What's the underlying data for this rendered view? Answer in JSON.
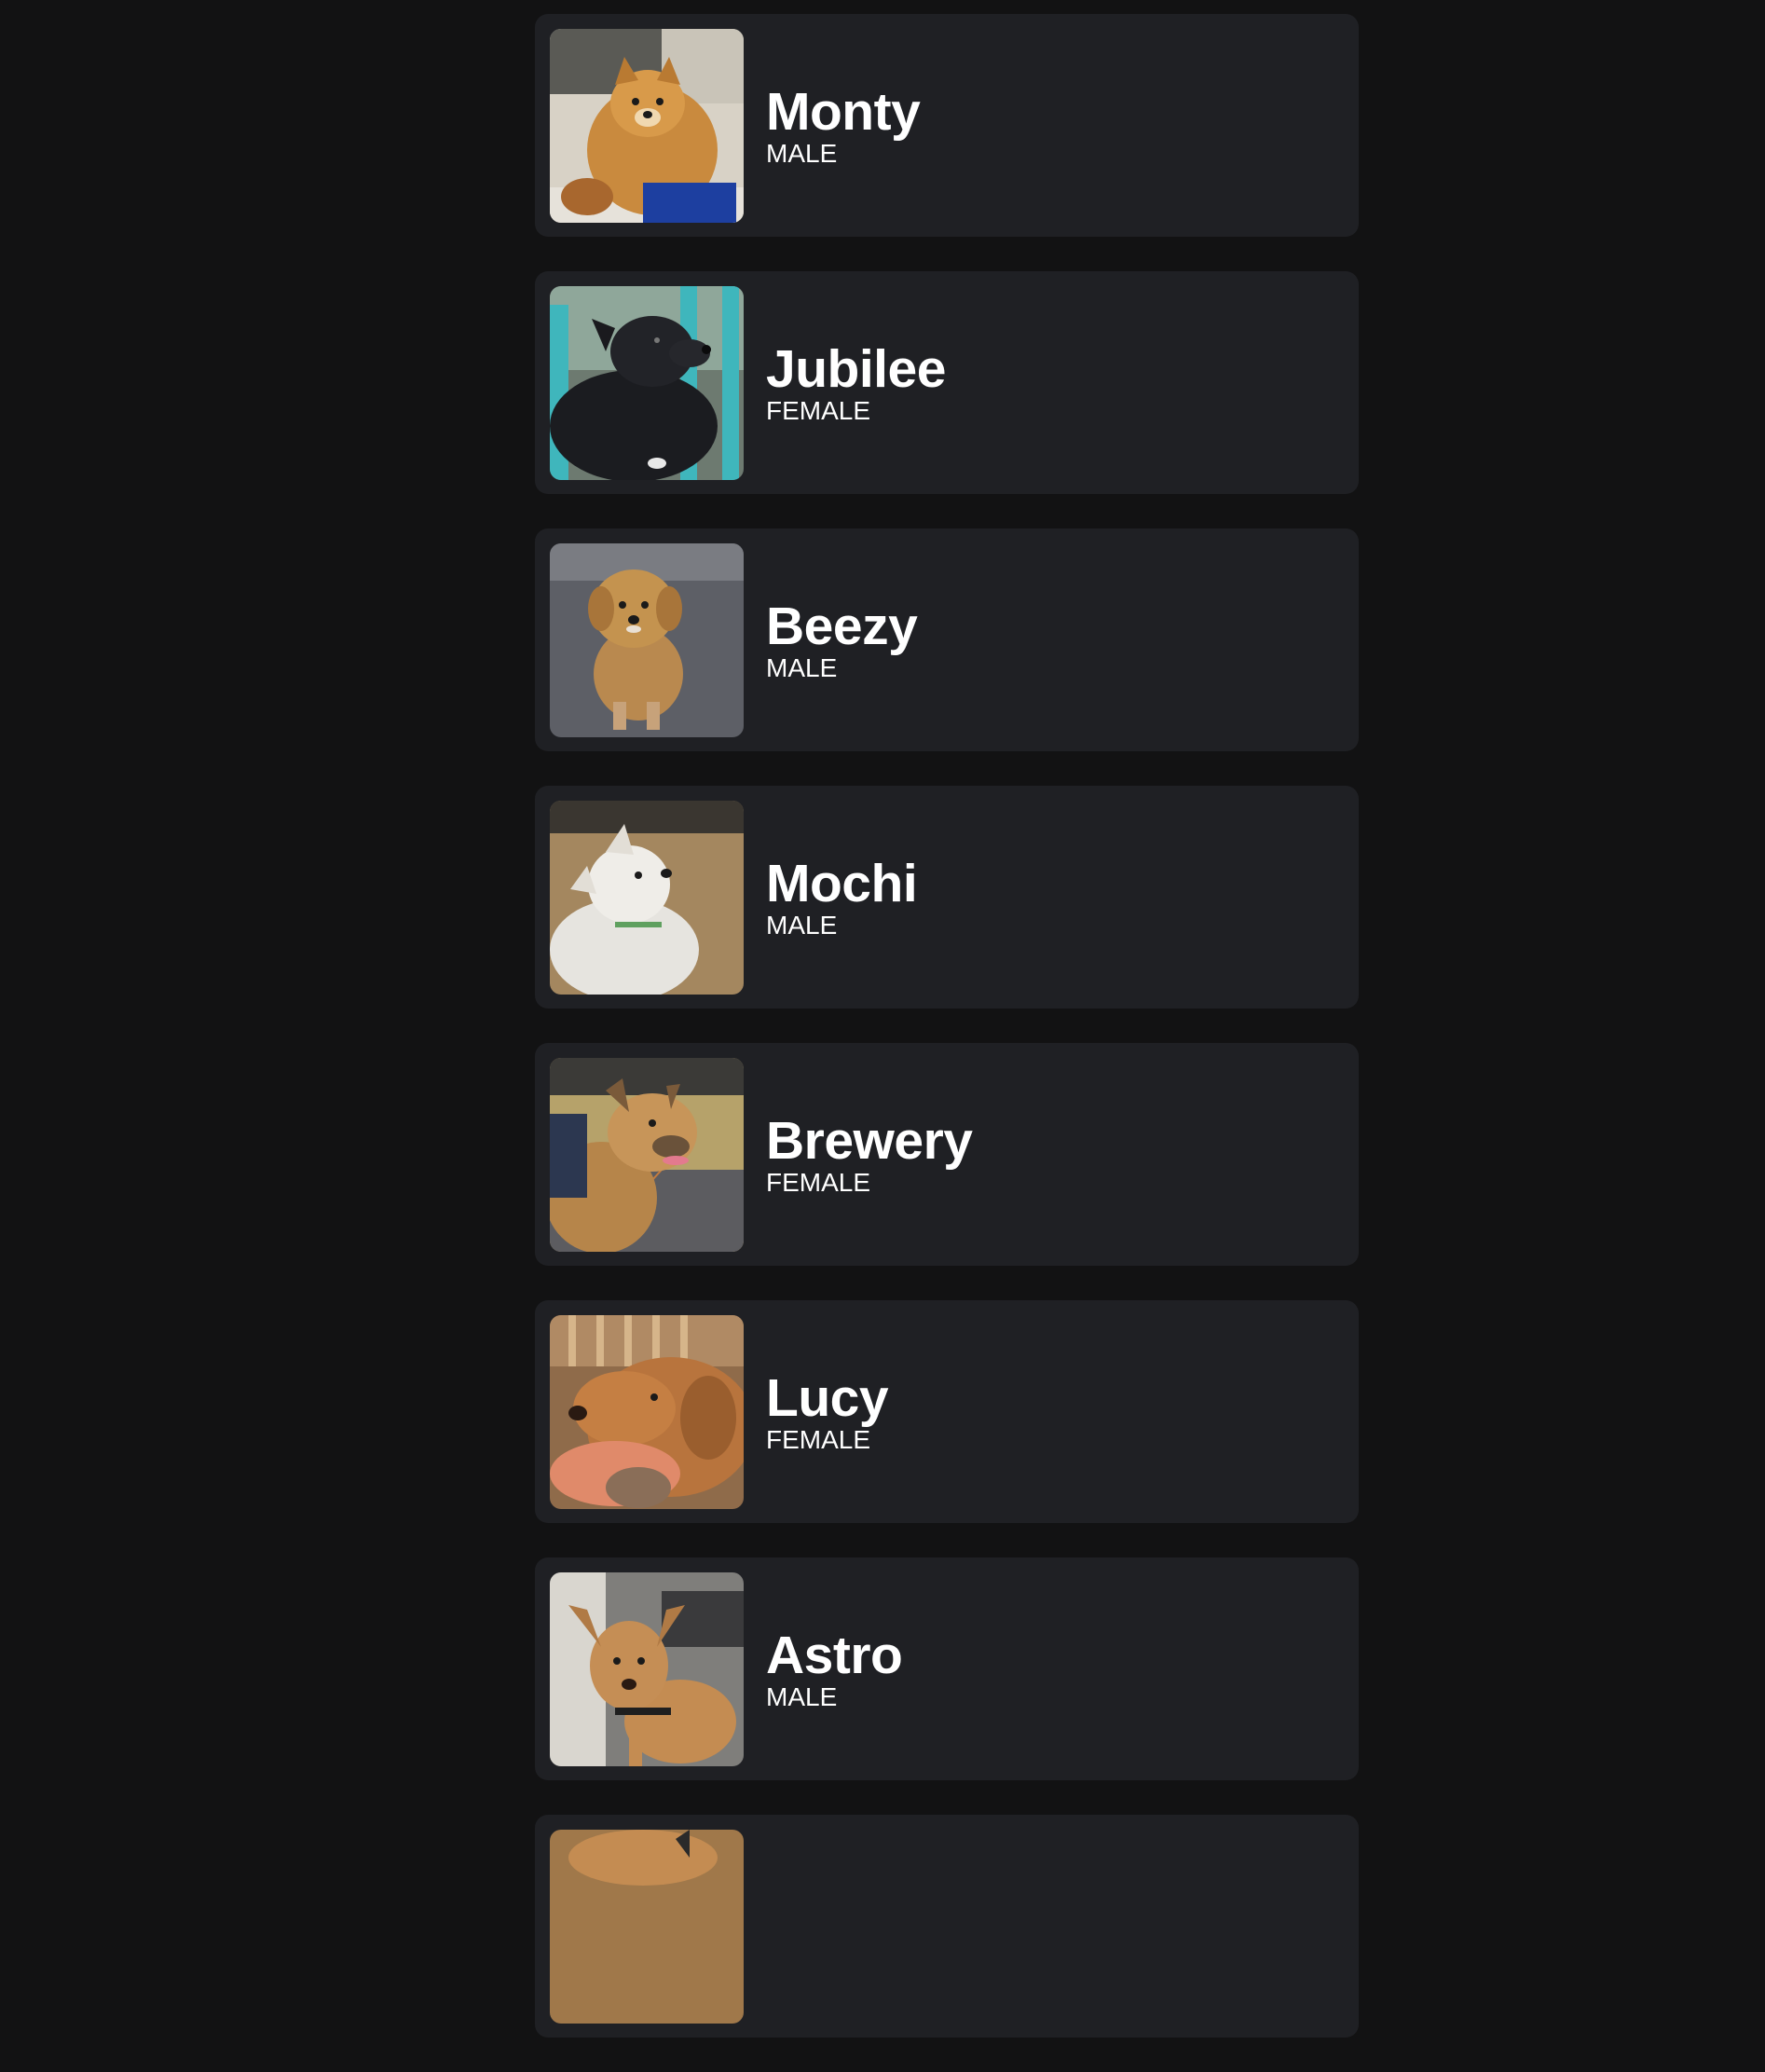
{
  "dogs": [
    {
      "name": "Monty",
      "gender": "MALE"
    },
    {
      "name": "Jubilee",
      "gender": "FEMALE"
    },
    {
      "name": "Beezy",
      "gender": "MALE"
    },
    {
      "name": "Mochi",
      "gender": "MALE"
    },
    {
      "name": "Brewery",
      "gender": "FEMALE"
    },
    {
      "name": "Lucy",
      "gender": "FEMALE"
    },
    {
      "name": "Astro",
      "gender": "MALE"
    },
    {
      "name": "",
      "gender": ""
    }
  ]
}
